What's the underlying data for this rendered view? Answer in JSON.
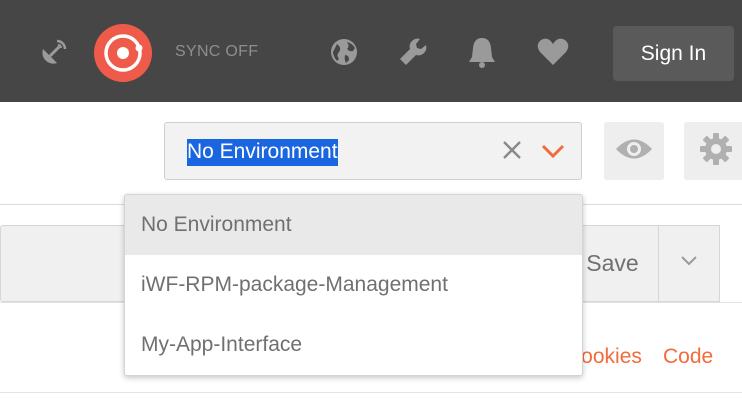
{
  "header": {
    "sync_status": "SYNC OFF",
    "signin_label": "Sign In",
    "icons": [
      "satellite-icon",
      "sync-logo-icon",
      "globe-icon",
      "wrench-icon",
      "bell-icon",
      "heart-icon"
    ]
  },
  "environment": {
    "selected": "No Environment",
    "options": [
      "No Environment",
      "iWF-RPM-package-Management",
      "My-App-Interface"
    ],
    "accent_color": "#f26b3a",
    "selection_color": "#1a66e0"
  },
  "request": {
    "save_label": "Save"
  },
  "links": {
    "cookies": "Cookies",
    "code": "Code"
  }
}
